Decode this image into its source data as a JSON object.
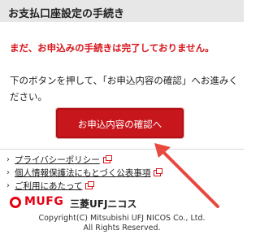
{
  "header": {
    "title": "お支払口座設定の手続き"
  },
  "main": {
    "warning": "まだ、お申込みの手続きは完了しておりません。",
    "instruction": "下のボタンを押して、「お申込内容の確認」へお進みください。",
    "confirm_button": "お申込内容の確認へ"
  },
  "footer": {
    "links": [
      {
        "label": "プライバシーポリシー",
        "icon": "external-link-icon"
      },
      {
        "label": "個人情報保護法にもとづく公表事項",
        "icon": "external-link-icon"
      },
      {
        "label": "ご利用にあたって",
        "icon": "external-link-icon"
      }
    ],
    "logo_text": "MUFG",
    "company_name": "三菱UFJニコス",
    "copyright_line1": "Copyright(C) Mitsubishi UFJ NICOS Co., Ltd.",
    "copyright_line2": "All Rights Reserved."
  },
  "colors": {
    "accent_red": "#d7141a",
    "button_red": "#c8161d",
    "header_bg": "#e7e7e7"
  }
}
